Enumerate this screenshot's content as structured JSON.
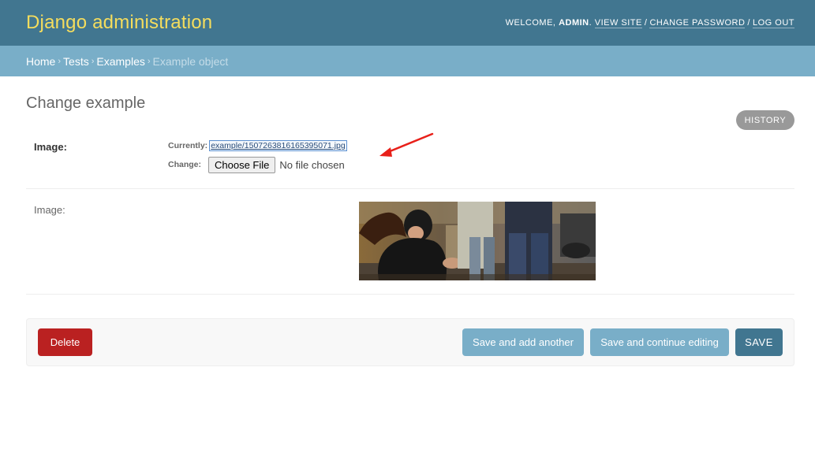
{
  "header": {
    "branding": "Django administration",
    "welcome": "Welcome,",
    "username": "admin",
    "view_site": "View site",
    "change_password": "Change password",
    "log_out": "Log out"
  },
  "breadcrumbs": {
    "home": "Home",
    "app": "Tests",
    "model": "Examples",
    "current": "Example object"
  },
  "content": {
    "title": "Change example",
    "history": "History"
  },
  "form": {
    "image_field": {
      "label": "Image:",
      "currently_label": "Currently:",
      "current_value": "example/1507263816165395071.jpg",
      "change_label": "Change:",
      "choose_file": "Choose File",
      "file_status": "No file chosen"
    },
    "image_preview": {
      "label": "Image:"
    }
  },
  "submit_row": {
    "delete": "Delete",
    "save_add_another": "Save and add another",
    "save_continue": "Save and continue editing",
    "save": "Save"
  },
  "colors": {
    "header_bg": "#417690",
    "branding": "#f5dd5d",
    "breadcrumbs_bg": "#79aec8",
    "delete": "#ba2121",
    "save": "#417690",
    "annotation_arrow": "#e8201a"
  }
}
